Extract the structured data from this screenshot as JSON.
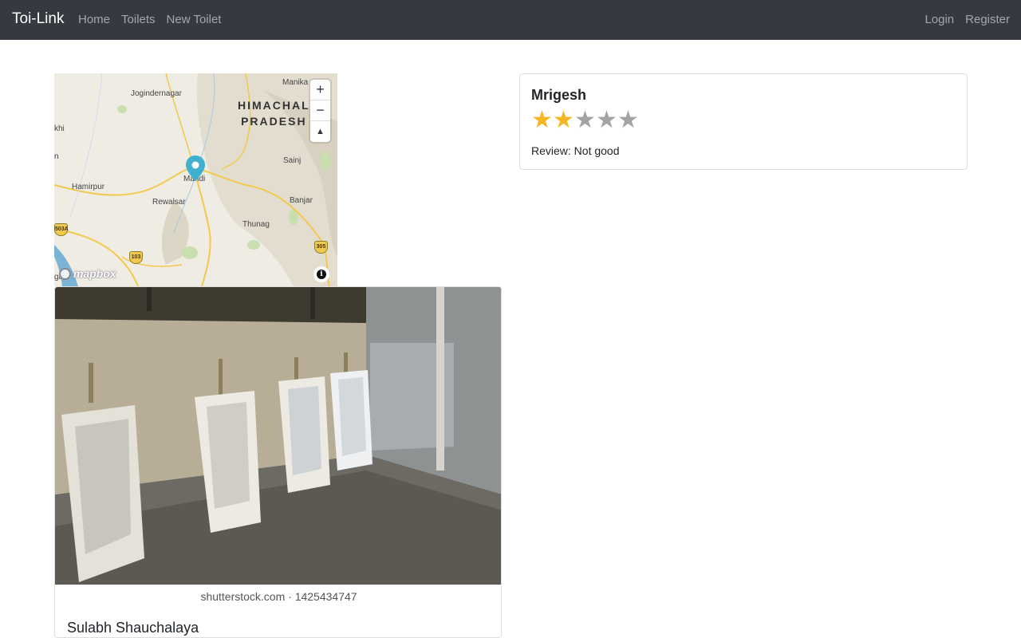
{
  "navbar": {
    "brand": "Toi-Link",
    "links": [
      "Home",
      "Toilets",
      "New Toilet"
    ],
    "auth": [
      "Login",
      "Register"
    ]
  },
  "map": {
    "places": {
      "manikaran": "Manika",
      "jogindernagar": "Jogindernagar",
      "khi": "khi",
      "n": "n",
      "hamirpur": "Hamirpur",
      "mandi": "Mandi",
      "sainj": "Sainj",
      "rewalsar": "Rewalsar",
      "banjar": "Banjar",
      "thunag": "Thunag",
      "ga": "ga"
    },
    "state_line1": "HIMACHAL",
    "state_line2": "PRADESH",
    "shields": {
      "s503a": "503A",
      "s103": "103",
      "s305": "305"
    },
    "zoom_in": "+",
    "zoom_out": "−",
    "compass": "▲",
    "info": "i",
    "attribution": "mapbox",
    "colors": {
      "land": "#efece4",
      "marker": "#3fb1ce",
      "road": "#f2c94c",
      "water": "#7ab3d3"
    }
  },
  "photo_card": {
    "watermark": "shutterstock.com · 1425434747",
    "title": "Sulabh Shauchalaya"
  },
  "review": {
    "author": "Mrigesh",
    "rating": 2,
    "max_rating": 5,
    "text": "Review: Not good",
    "colors": {
      "star_on": "#f4b622",
      "star_off": "#a3a3a3"
    }
  }
}
